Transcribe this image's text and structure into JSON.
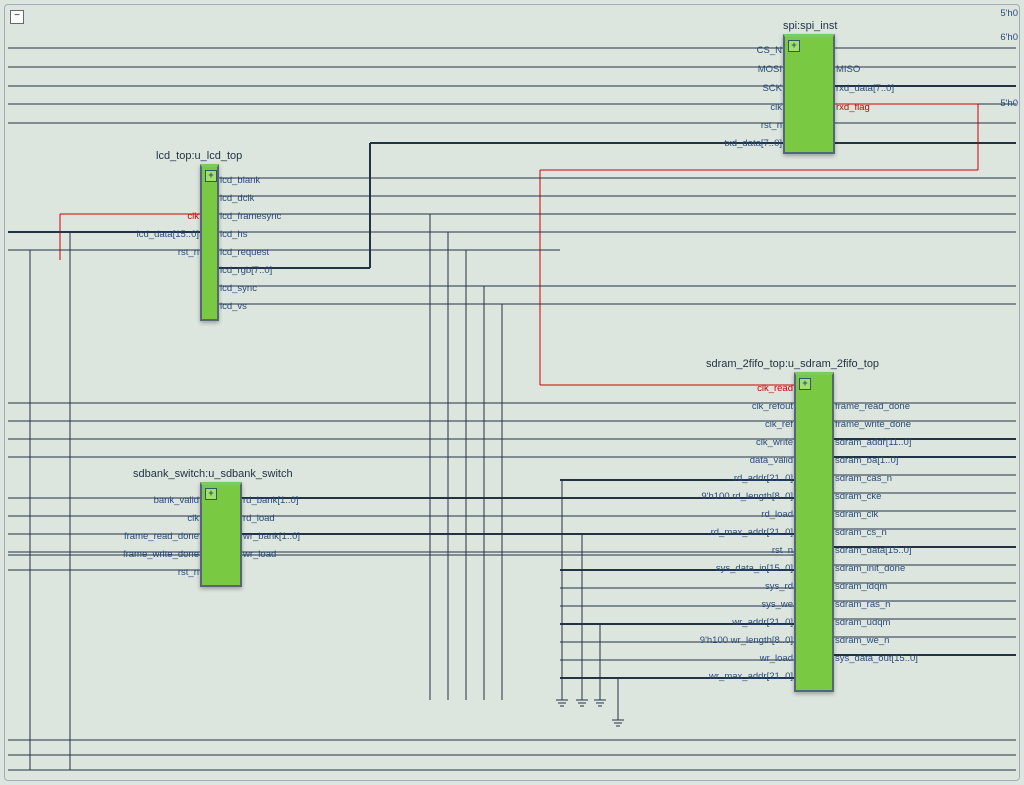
{
  "topRight": {
    "v1": "5'h0",
    "v2": "6'h0",
    "v3": "5'h0"
  },
  "blocks": {
    "spi": {
      "title": "spi:spi_inst",
      "left": [
        "CS_N",
        "MOSI",
        "SCK",
        "clk",
        "rst_n",
        "txd_data[7..0]"
      ],
      "right": [
        "",
        "MISO",
        "rxd_data[7..0]",
        "rxd_flag"
      ]
    },
    "lcd": {
      "title": "lcd_top:u_lcd_top",
      "left": [
        "clk",
        "lcd_data[15..0]",
        "rst_n"
      ],
      "right": [
        "lcd_blank",
        "lcd_dclk",
        "lcd_framesync",
        "lcd_hs",
        "lcd_request",
        "lcd_rgb[7..0]",
        "lcd_sync",
        "lcd_vs"
      ]
    },
    "sw": {
      "title": "sdbank_switch:u_sdbank_switch",
      "left": [
        "bank_valid",
        "clk",
        "frame_read_done",
        "frame_write_done",
        "rst_n"
      ],
      "right": [
        "rd_bank[1..0]",
        "rd_load",
        "wr_bank[1..0]",
        "wr_load"
      ]
    },
    "sdram": {
      "title": "sdram_2fifo_top:u_sdram_2fifo_top",
      "left": [
        "clk_read",
        "clk_refout",
        "clk_ref",
        "clk_write",
        "data_valid",
        "rd_addr[21..0]",
        "rd_length[8..0]",
        "rd_load",
        "rd_max_addr[21..0]",
        "rst_n",
        "sys_data_in[15..0]",
        "sys_rd",
        "sys_we",
        "wr_addr[21..0]",
        "wr_length[8..0]",
        "wr_load",
        "wr_max_addr[21..0]"
      ],
      "leftPrefix": {
        "6": "9'h100",
        "14": "9'h100"
      },
      "right": [
        "frame_read_done",
        "frame_write_done",
        "sdram_addr[11..0]",
        "sdram_ba[1..0]",
        "sdram_cas_n",
        "sdram_cke",
        "sdram_clk",
        "sdram_cs_n",
        "sdram_data[15..0]",
        "sdram_init_done",
        "sdram_ldqm",
        "sdram_ras_n",
        "sdram_udqm",
        "sdram_we_n",
        "sys_data_out[15..0]"
      ]
    }
  }
}
